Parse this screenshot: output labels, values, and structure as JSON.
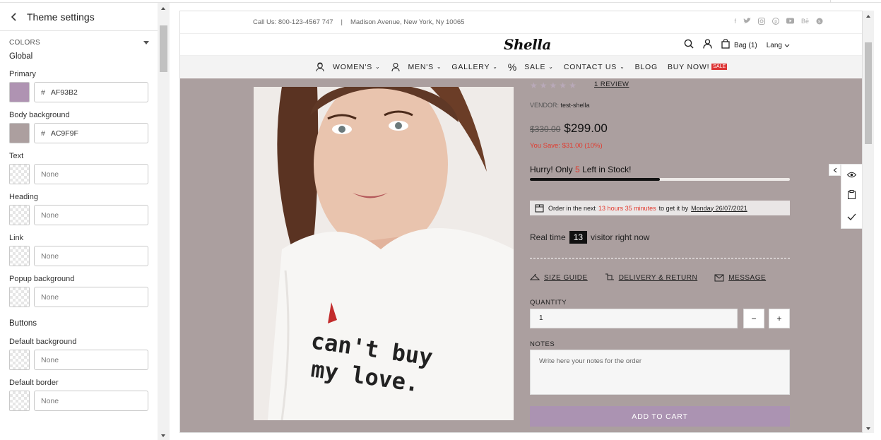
{
  "panel": {
    "title": "Theme settings",
    "section": "COLORS",
    "global_heading": "Global",
    "buttons_heading": "Buttons",
    "fields": [
      {
        "label": "Primary",
        "value": "AF93B2",
        "color": "#AF93B2",
        "hash": "#"
      },
      {
        "label": "Body background",
        "value": "AC9F9F",
        "color": "#AC9F9F",
        "hash": "#"
      },
      {
        "label": "Text",
        "value": "None"
      },
      {
        "label": "Heading",
        "value": "None"
      },
      {
        "label": "Link",
        "value": "None"
      },
      {
        "label": "Popup background",
        "value": "None"
      }
    ],
    "button_fields": [
      {
        "label": "Default background",
        "value": "None"
      },
      {
        "label": "Default border",
        "value": "None"
      }
    ]
  },
  "store": {
    "topbar": {
      "phone": "Call Us: 800-123-4567 747",
      "sep": "|",
      "address": "Madison Avenue, New York, Ny 10065"
    },
    "socials": [
      "f",
      "t",
      "ig",
      "p",
      "yt",
      "Bē",
      "s"
    ],
    "logo": "Shella",
    "bag": "Bag (1)",
    "lang": "Lang",
    "nav": [
      "WOMEN'S",
      "MEN'S",
      "GALLERY",
      "SALE",
      "CONTACT US",
      "BLOG",
      "BUY NOW!"
    ],
    "sale_badge": "SALE"
  },
  "product": {
    "review": "1 REVIEW",
    "vendor_label": "VENDOR:",
    "vendor": "test-shella",
    "old_price": "$330.00",
    "price": "$299.00",
    "save": "You Save: $31.00 (10%)",
    "hurry_pre": "Hurry! Only",
    "hurry_num": "5",
    "hurry_post": "Left in Stock!",
    "stock_fill": 0.5,
    "order_pre": "Order in the next",
    "order_time": "13 hours 35 minutes",
    "order_mid": "to get it by",
    "order_date": "Monday 26/07/2021",
    "realtime_pre": "Real time",
    "realtime_count": "13",
    "realtime_post": "visitor right now",
    "size_guide": "SIZE GUIDE",
    "delivery": "DELIVERY & RETURN",
    "message": "MESSAGE",
    "qty_label": "QUANTITY",
    "qty_value": "1",
    "minus": "−",
    "plus": "+",
    "notes_label": "NOTES",
    "notes_placeholder": "Write here your notes for the order",
    "add_to_cart": "ADD TO CART",
    "shirt_text_1": "can't buy",
    "shirt_text_2": "my love."
  },
  "colors": {
    "primary": "#AF93B2",
    "body_bg": "#AC9F9F",
    "sale_red": "#E23A2E"
  }
}
